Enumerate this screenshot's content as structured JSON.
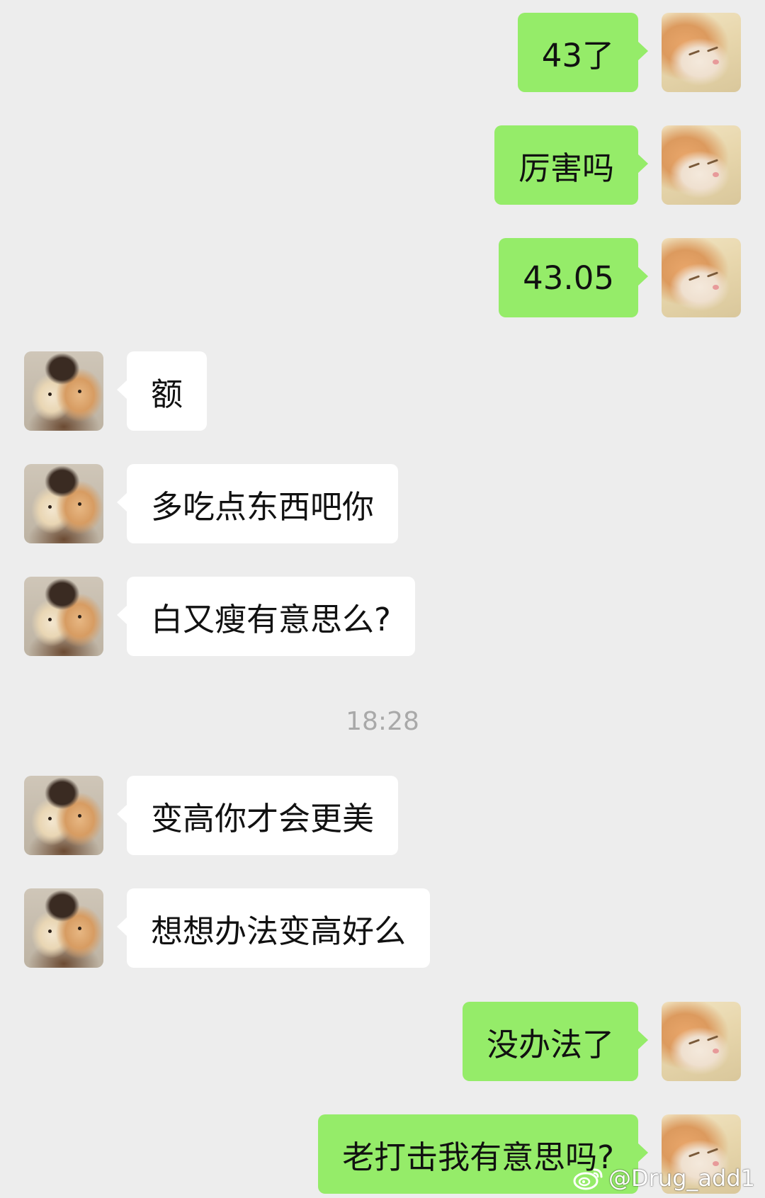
{
  "messages": [
    {
      "side": "me",
      "text": "43了"
    },
    {
      "side": "me",
      "text": "厉害吗"
    },
    {
      "side": "me",
      "text": "43.05"
    },
    {
      "side": "other",
      "text": "额"
    },
    {
      "side": "other",
      "text": "多吃点东西吧你"
    },
    {
      "side": "other",
      "text": "白又瘦有意思么?"
    },
    {
      "side": "other",
      "text": "变高你才会更美"
    },
    {
      "side": "other",
      "text": "想想办法变高好么"
    },
    {
      "side": "me",
      "text": "没办法了"
    },
    {
      "side": "me",
      "text": "老打击我有意思吗?"
    }
  ],
  "timestamp": "18:28",
  "watermark": {
    "handle": "@Drug_add1",
    "icon": "weibo-logo-icon"
  },
  "colors": {
    "background": "#ededed",
    "sent_bubble": "#95ec69",
    "received_bubble": "#ffffff",
    "timestamp_text": "#a9a9a9"
  }
}
